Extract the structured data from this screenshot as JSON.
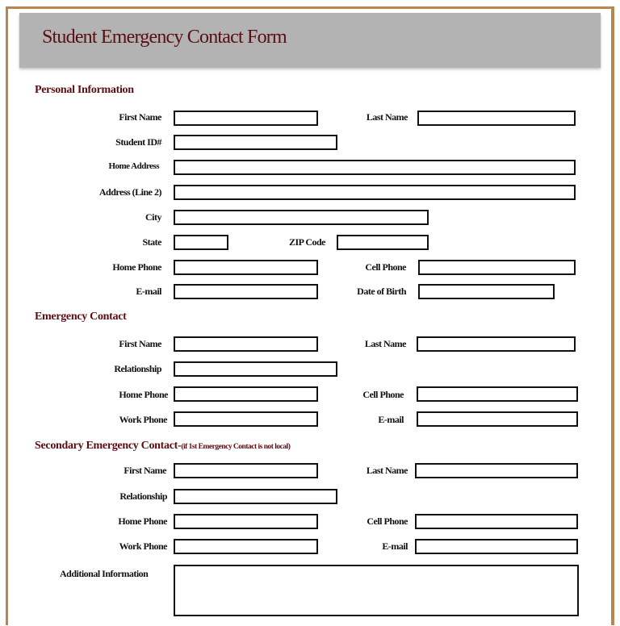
{
  "form": {
    "title": "Student Emergency Contact Form",
    "sections": {
      "personal": "Personal Information",
      "emergency": "Emergency Contact",
      "secondary": "Secondary Emergency Contact-",
      "secondary_note": "(if 1st Emergency Contact is not local)"
    },
    "personal": {
      "first_name": "First Name",
      "last_name": "Last Name",
      "student_id": "Student ID#",
      "home_address": "Home Address",
      "address_line2": "Address (Line 2)",
      "city": "City",
      "state": "State",
      "zip": "ZIP Code",
      "home_phone": "Home Phone",
      "cell_phone": "Cell Phone",
      "email": "E-mail",
      "dob": "Date of Birth"
    },
    "emergency": {
      "first_name": "First Name",
      "last_name": "Last Name",
      "relationship": "Relationship",
      "home_phone": "Home Phone",
      "cell_phone": "Cell Phone",
      "work_phone": "Work Phone",
      "email": "E-mail"
    },
    "secondary": {
      "first_name": "First Name",
      "last_name": "Last Name",
      "relationship": "Relationship",
      "home_phone": "Home Phone",
      "cell_phone": "Cell Phone",
      "work_phone": "Work Phone",
      "email": "E-mail"
    },
    "additional_info": "Additional Information"
  },
  "colors": {
    "accent": "#5a0d12",
    "header_bg": "#b3b3b3",
    "page_border": "#b8864e"
  }
}
